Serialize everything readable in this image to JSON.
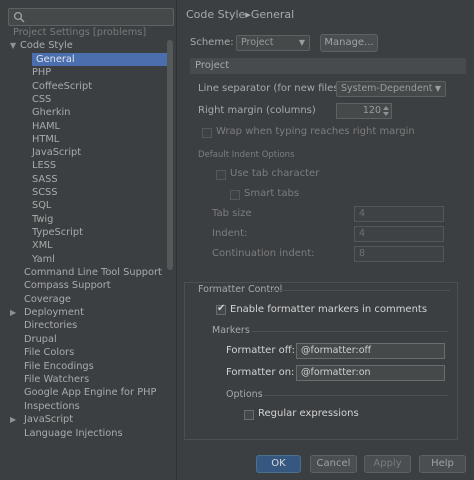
{
  "search": {
    "placeholder": ""
  },
  "sidebar": {
    "header": "Project Settings [problems]",
    "code_style": "Code Style",
    "children": [
      "General",
      "PHP",
      "CoffeeScript",
      "CSS",
      "Gherkin",
      "HAML",
      "HTML",
      "JavaScript",
      "LESS",
      "SASS",
      "SCSS",
      "SQL",
      "Twig",
      "TypeScript",
      "XML",
      "Yaml"
    ],
    "items": [
      "Command Line Tool Support",
      "Compass Support",
      "Coverage",
      "Deployment",
      "Directories",
      "Drupal",
      "File Colors",
      "File Encodings",
      "File Watchers",
      "Google App Engine for PHP",
      "Inspections",
      "JavaScript",
      "Language Injections"
    ]
  },
  "header": {
    "breadcrumb_root": "Code Style",
    "breadcrumb_sep": "▸",
    "breadcrumb_leaf": "General"
  },
  "scheme": {
    "label": "Scheme:",
    "value": "Project",
    "manage_label": "Manage..."
  },
  "project": {
    "title": "Project",
    "line_sep_label": "Line separator (for new files):",
    "line_sep_value": "System-Dependent",
    "right_margin_label": "Right margin (columns)",
    "right_margin_value": "120",
    "wrap_label": "Wrap when typing reaches right margin",
    "indent_title": "Default Indent Options",
    "tab_char_label": "Use tab character",
    "smart_tabs_label": "Smart tabs",
    "tab_size_label": "Tab size",
    "tab_size_value": "4",
    "indent_label": "Indent:",
    "indent_value": "4",
    "cont_indent_label": "Continuation indent:",
    "cont_indent_value": "8"
  },
  "formatter": {
    "title": "Formatter Control",
    "enable_label": "Enable formatter markers in comments",
    "markers_title": "Markers",
    "off_label": "Formatter off:",
    "off_value": "@formatter:off",
    "on_label": "Formatter on:",
    "on_value": "@formatter:on",
    "options_title": "Options",
    "regex_label": "Regular expressions"
  },
  "buttons": {
    "ok": "OK",
    "cancel": "Cancel",
    "apply": "Apply",
    "help": "Help"
  }
}
